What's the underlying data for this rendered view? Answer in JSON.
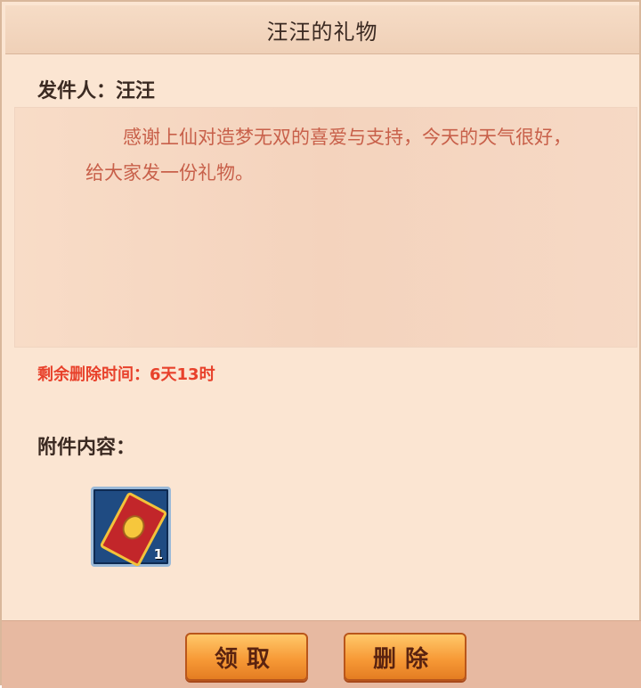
{
  "dialog": {
    "title": "汪汪的礼物",
    "sender": "发件人：汪汪",
    "message": "感谢上仙对造梦无双的喜爱与支持，今天的天气很好，给大家发一份礼物。",
    "expire_text": "剩余删除时间：6天13时",
    "attachment_label": "附件内容：",
    "attachment": {
      "icon": "red-envelope-card-icon",
      "count": "1"
    },
    "buttons": {
      "receive": "领取",
      "delete": "删除"
    }
  },
  "colors": {
    "panel_bg": "#fbe5d2",
    "message_text": "#c8604a",
    "expire_text": "#e8412b",
    "button": "#f79a37"
  }
}
